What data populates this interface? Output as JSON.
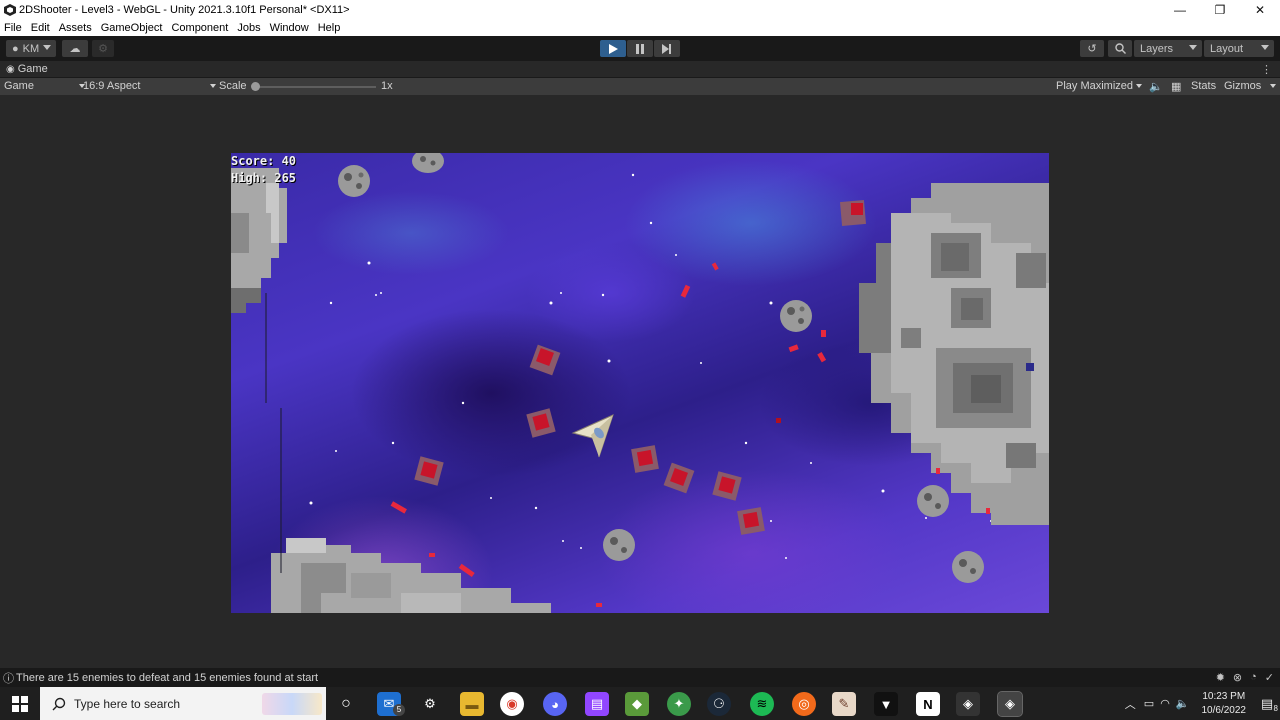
{
  "window": {
    "title": "2DShooter - Level3 - WebGL - Unity 2021.3.10f1 Personal* <DX11>",
    "minimize_glyph": "—",
    "restore_glyph": "❐",
    "close_glyph": "✕"
  },
  "menu": [
    "File",
    "Edit",
    "Assets",
    "GameObject",
    "Component",
    "Jobs",
    "Window",
    "Help"
  ],
  "toolbar": {
    "account_label": "KM",
    "layers_label": "Layers",
    "layout_label": "Layout"
  },
  "game_tab": {
    "label": "Game",
    "kebab": "⋮"
  },
  "game_toolbar": {
    "display_label": "Game",
    "aspect_label": "16:9 Aspect",
    "scale_label": "Scale",
    "scale_value": "1x",
    "play_mode_label": "Play Maximized",
    "stats_label": "Stats",
    "gizmos_label": "Gizmos"
  },
  "hud": {
    "score": "Score: 40",
    "high": "High: 265"
  },
  "status": {
    "message": "There are 15 enemies to defeat and 15 enemies found at start"
  },
  "taskbar": {
    "search_placeholder": "Type here to search",
    "mail_badge": "5",
    "time": "10:23 PM",
    "date": "10/6/2022",
    "notification_count": "8"
  },
  "colors": {
    "editor_bg": "#282828",
    "toolbar_bg": "#191919",
    "play_active": "#2e5f8f",
    "enemy_red": "#c8142a",
    "asteroid_gray": "#a8a8a8"
  }
}
